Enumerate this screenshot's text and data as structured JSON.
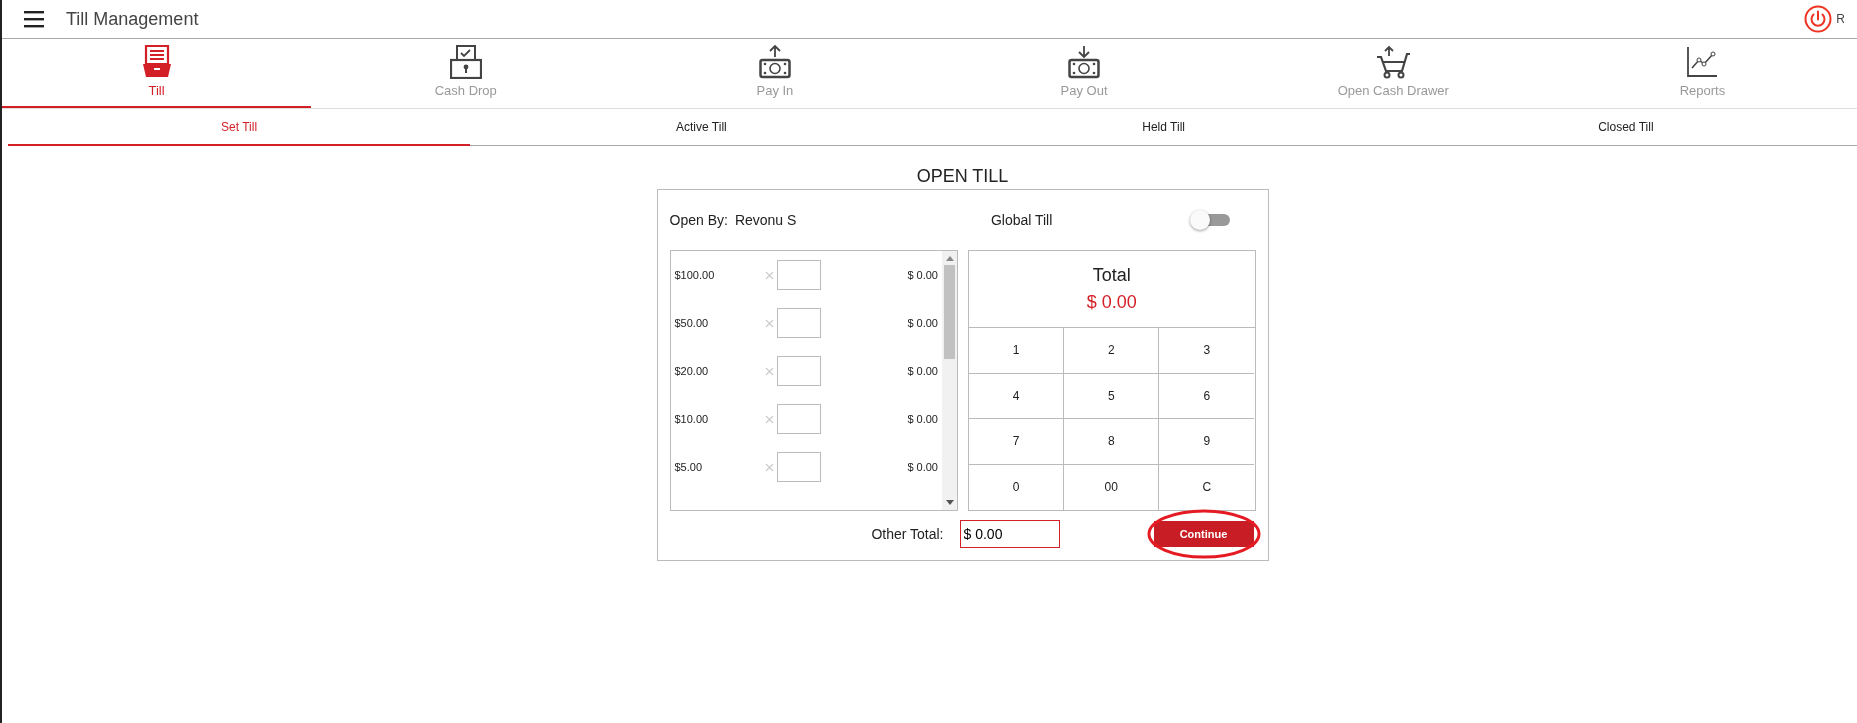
{
  "header": {
    "title": "Till Management",
    "user_initial": "R"
  },
  "nav_tabs": [
    {
      "label": "Till",
      "kind": "till",
      "selected": true
    },
    {
      "label": "Cash Drop",
      "kind": "drop",
      "selected": false
    },
    {
      "label": "Pay In",
      "kind": "payin",
      "selected": false
    },
    {
      "label": "Pay Out",
      "kind": "payout",
      "selected": false
    },
    {
      "label": "Open Cash Drawer",
      "kind": "cart",
      "selected": false
    },
    {
      "label": "Reports",
      "kind": "chart",
      "selected": false
    }
  ],
  "sub_tabs": [
    {
      "label": "Set Till",
      "selected": true
    },
    {
      "label": "Active Till",
      "selected": false
    },
    {
      "label": "Held Till",
      "selected": false
    },
    {
      "label": "Closed Till",
      "selected": false
    }
  ],
  "dialog": {
    "title": "OPEN TILL",
    "open_by_label": "Open By:",
    "open_by_value": "Revonu S",
    "global_till_label": "Global Till",
    "global_till_on": false,
    "denominations": [
      {
        "name": "$100.00",
        "amount": "$ 0.00"
      },
      {
        "name": "$50.00",
        "amount": "$ 0.00"
      },
      {
        "name": "$20.00",
        "amount": "$ 0.00"
      },
      {
        "name": "$10.00",
        "amount": "$ 0.00"
      },
      {
        "name": "$5.00",
        "amount": "$ 0.00"
      }
    ],
    "total_label": "Total",
    "total_value": "$ 0.00",
    "keypad": [
      "1",
      "2",
      "3",
      "4",
      "5",
      "6",
      "7",
      "8",
      "9",
      "0",
      "00",
      "C"
    ],
    "other_total_label": "Other Total:",
    "other_total_value": "$ 0.00",
    "continue_button": "Continue"
  }
}
